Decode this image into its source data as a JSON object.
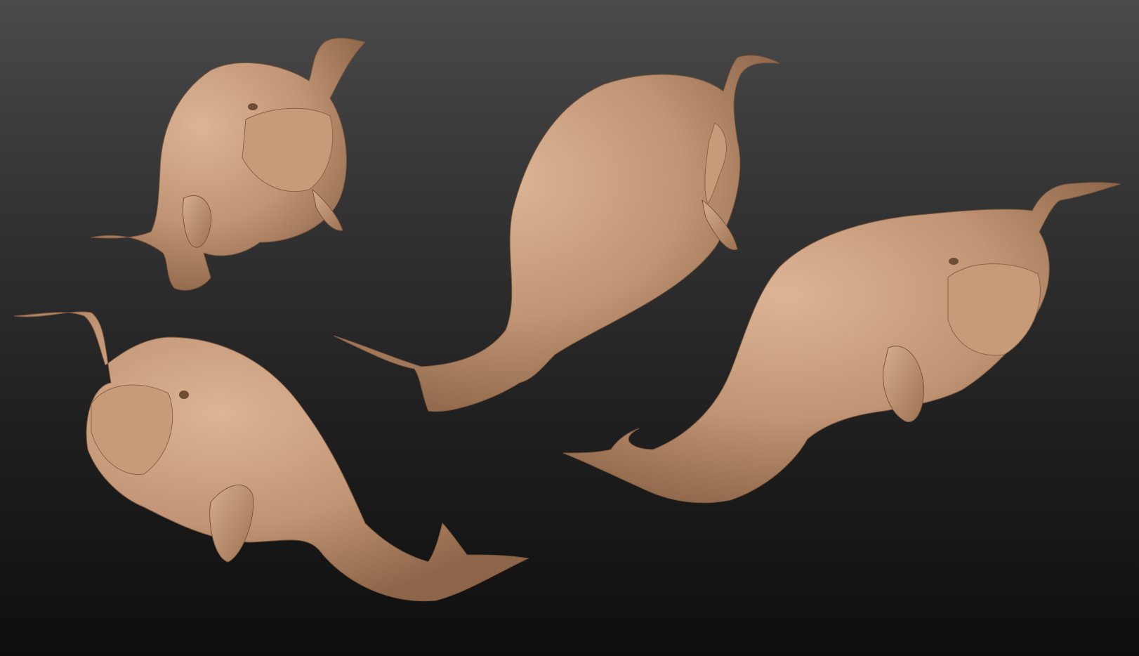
{
  "scene": {
    "subject": "whale-creature-sculpt",
    "material": "clay",
    "colors": {
      "clay": "#c09474",
      "clay_shadow": "#8d6548",
      "clay_highlight": "#dcb596",
      "background_top": "#4a4a4a",
      "background_bottom": "#0e0e0e"
    },
    "sculpt_count": 4
  }
}
